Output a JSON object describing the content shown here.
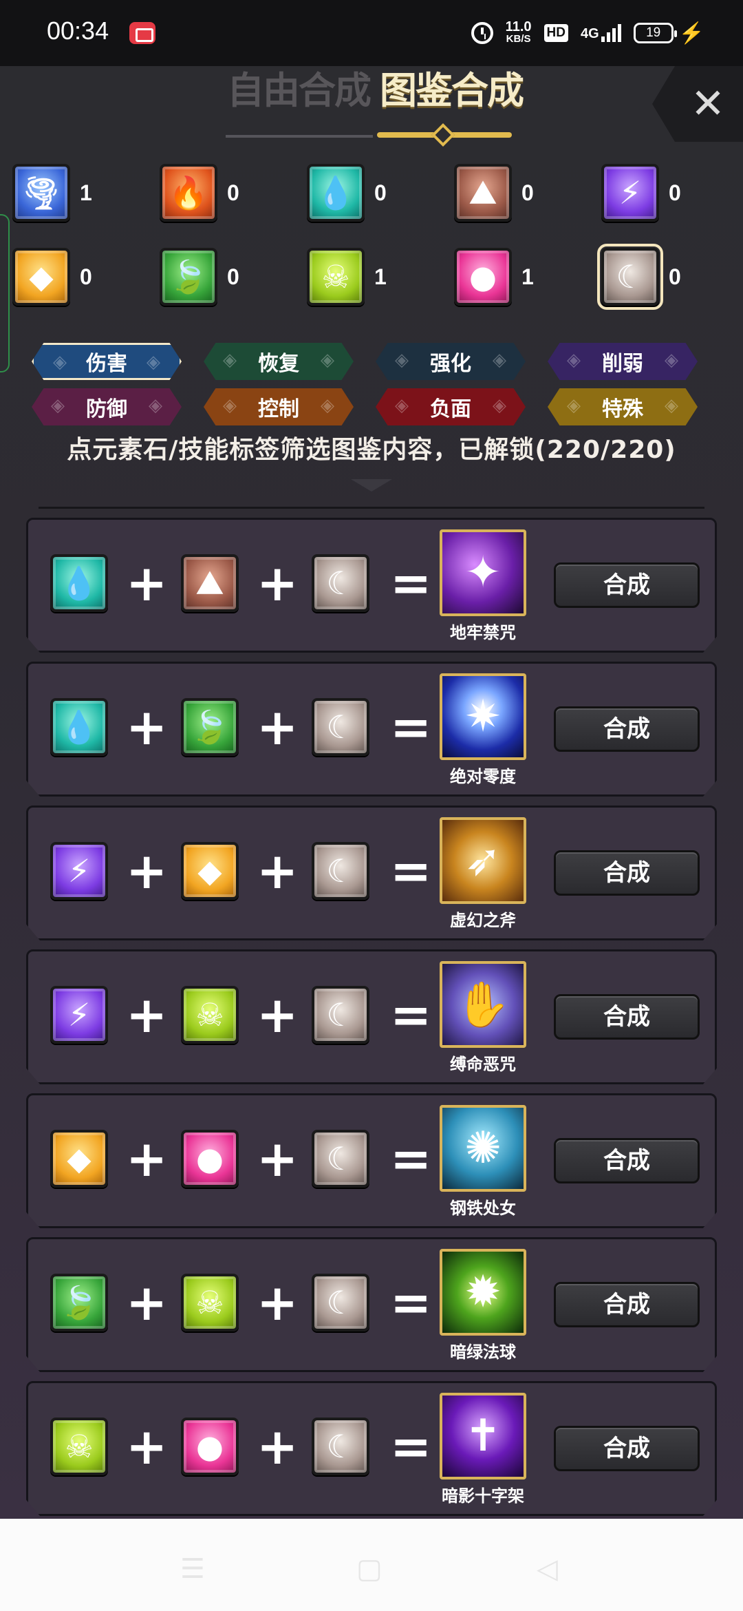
{
  "status_bar": {
    "time": "00:34",
    "net_speed": "11.0",
    "net_unit": "KB/S",
    "hd": "HD",
    "network": "4G",
    "battery": "19"
  },
  "header": {
    "tab_free": "自由合成",
    "tab_catalog": "图鉴合成",
    "close": "✕"
  },
  "elements": [
    {
      "name": "wind",
      "glyph": "🌪",
      "count": "1"
    },
    {
      "name": "fire",
      "glyph": "🔥",
      "count": "0"
    },
    {
      "name": "water",
      "glyph": "💧",
      "count": "0"
    },
    {
      "name": "earth",
      "glyph": "⛰",
      "count": "0"
    },
    {
      "name": "thunder",
      "glyph": "⚡",
      "count": "0"
    },
    {
      "name": "light",
      "glyph": "◆",
      "count": "0"
    },
    {
      "name": "nature",
      "glyph": "🍃",
      "count": "0"
    },
    {
      "name": "poison",
      "glyph": "☠",
      "count": "1"
    },
    {
      "name": "charm",
      "glyph": "●",
      "count": "1"
    },
    {
      "name": "moon",
      "glyph": "☾",
      "count": "0"
    }
  ],
  "tags": [
    {
      "label": "伤害",
      "selected": true
    },
    {
      "label": "恢复"
    },
    {
      "label": "强化"
    },
    {
      "label": "削弱"
    },
    {
      "label": "防御"
    },
    {
      "label": "控制"
    },
    {
      "label": "负面"
    },
    {
      "label": "特殊"
    }
  ],
  "filter_text": "点元素石/技能标签筛选图鉴内容，已解锁(220/220)",
  "recipes": [
    {
      "g1": "water",
      "g2": "earth",
      "g3": "moon",
      "skill": "地牢禁咒",
      "skill_glyph": "✦"
    },
    {
      "g1": "water",
      "g2": "nature",
      "g3": "moon",
      "skill": "绝对零度",
      "skill_glyph": "✷"
    },
    {
      "g1": "thunder",
      "g2": "light",
      "g3": "moon",
      "skill": "虚幻之斧",
      "skill_glyph": "➶"
    },
    {
      "g1": "thunder",
      "g2": "poison",
      "g3": "moon",
      "skill": "缚命恶咒",
      "skill_glyph": "✋"
    },
    {
      "g1": "light",
      "g2": "charm",
      "g3": "moon",
      "skill": "钢铁处女",
      "skill_glyph": "✺"
    },
    {
      "g1": "nature",
      "g2": "poison",
      "g3": "moon",
      "skill": "暗绿法球",
      "skill_glyph": "✹"
    },
    {
      "g1": "poison",
      "g2": "charm",
      "g3": "moon",
      "skill": "暗影十字架",
      "skill_glyph": "✝"
    }
  ],
  "labels": {
    "plus": "+",
    "equals": "=",
    "craft": "合成"
  },
  "nav": {
    "menu": "☰",
    "home": "▢",
    "back": "◁"
  }
}
